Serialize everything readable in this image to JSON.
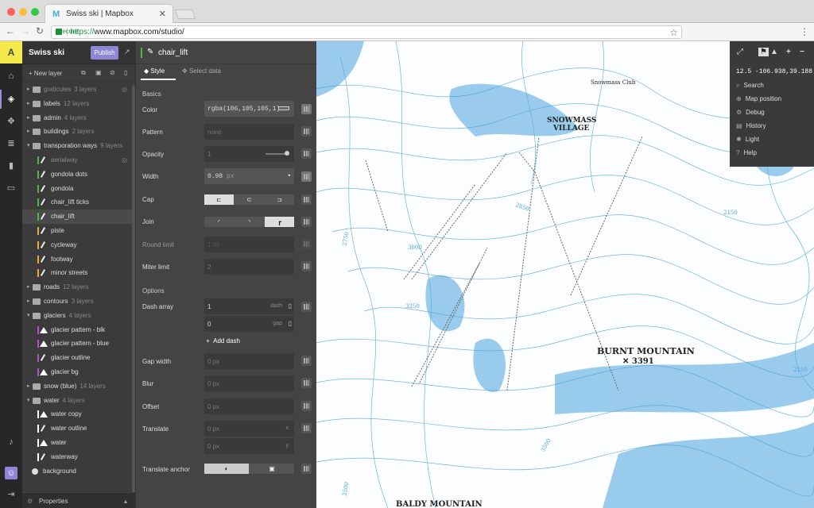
{
  "browser": {
    "tab_title": "Swiss ski | Mapbox",
    "secure_label": "Secure",
    "url_scheme": "https://",
    "url_rest": "www.mapbox.com/studio/"
  },
  "app": {
    "style_name": "Swiss ski",
    "publish_label": "Publish",
    "new_layer_label": "New layer",
    "logo_letter": "A",
    "accent_color": "#8f87d6"
  },
  "layers": [
    {
      "name": "graticules",
      "count": "3 layers",
      "kind": "folder",
      "indent": 0,
      "expanded": false,
      "hidden": true
    },
    {
      "name": "labels",
      "count": "12 layers",
      "kind": "folder",
      "indent": 0,
      "expanded": false
    },
    {
      "name": "admin",
      "count": "4 layers",
      "kind": "folder",
      "indent": 0,
      "expanded": false
    },
    {
      "name": "buildings",
      "count": "2 layers",
      "kind": "folder",
      "indent": 0,
      "expanded": false
    },
    {
      "name": "transporation ways",
      "count": "9 layers",
      "kind": "folder",
      "indent": 0,
      "expanded": true
    },
    {
      "name": "aerialway",
      "count": "",
      "kind": "line",
      "color": "#4db847",
      "indent": 1,
      "hidden": true
    },
    {
      "name": "gondola dots",
      "count": "",
      "kind": "line",
      "color": "#4db847",
      "indent": 1
    },
    {
      "name": "gondola",
      "count": "",
      "kind": "line",
      "color": "#4db847",
      "indent": 1
    },
    {
      "name": "chair_lift ticks",
      "count": "",
      "kind": "line",
      "color": "#4db847",
      "indent": 1
    },
    {
      "name": "chair_lift",
      "count": "",
      "kind": "line",
      "color": "#4db847",
      "indent": 1,
      "selected": true
    },
    {
      "name": "piste",
      "count": "",
      "kind": "line",
      "color": "#f0a830",
      "indent": 1
    },
    {
      "name": "cycleway",
      "count": "",
      "kind": "line",
      "color": "#f0a830",
      "indent": 1
    },
    {
      "name": "footway",
      "count": "",
      "kind": "line",
      "color": "#f0a830",
      "indent": 1
    },
    {
      "name": "minor streets",
      "count": "",
      "kind": "line",
      "color": "#f0a830",
      "indent": 1
    },
    {
      "name": "roads",
      "count": "12 layers",
      "kind": "folder",
      "indent": 0,
      "expanded": false
    },
    {
      "name": "contours",
      "count": "3 layers",
      "kind": "folder",
      "indent": 0,
      "expanded": false
    },
    {
      "name": "glaciers",
      "count": "4 layers",
      "kind": "folder",
      "indent": 0,
      "expanded": true
    },
    {
      "name": "glacier pattern - blk",
      "count": "",
      "kind": "fill",
      "color": "#b44fd0",
      "indent": 1
    },
    {
      "name": "glacier pattern - blue",
      "count": "",
      "kind": "fill",
      "color": "#b44fd0",
      "indent": 1
    },
    {
      "name": "glacier outline",
      "count": "",
      "kind": "line",
      "color": "#b44fd0",
      "indent": 1
    },
    {
      "name": "glacier bg",
      "count": "",
      "kind": "fill",
      "color": "#b44fd0",
      "indent": 1
    },
    {
      "name": "snow (blue)",
      "count": "14 layers",
      "kind": "folder",
      "indent": 0,
      "expanded": false
    },
    {
      "name": "water",
      "count": "4 layers",
      "kind": "folder",
      "indent": 0,
      "expanded": true
    },
    {
      "name": "water copy",
      "count": "",
      "kind": "fill",
      "color": "#ffffff",
      "indent": 1
    },
    {
      "name": "water outline",
      "count": "",
      "kind": "line",
      "color": "#ffffff",
      "indent": 1
    },
    {
      "name": "water",
      "count": "",
      "kind": "fill",
      "color": "#ffffff",
      "indent": 1
    },
    {
      "name": "waterway",
      "count": "",
      "kind": "line",
      "color": "#ffffff",
      "indent": 1
    },
    {
      "name": "background",
      "count": "",
      "kind": "background",
      "indent": 0
    }
  ],
  "properties_label": "Properties",
  "editor": {
    "layer_name": "chair_lift",
    "tab_style": "Style",
    "tab_select": "Select data",
    "section_basics": "Basics",
    "section_options": "Options",
    "color_label": "Color",
    "color_value": "rgba(106,105,105,1)",
    "pattern_label": "Pattern",
    "pattern_value": "none",
    "opacity_label": "Opacity",
    "opacity_value": "1",
    "width_label": "Width",
    "width_value": "0.98",
    "width_unit": "px",
    "cap_label": "Cap",
    "join_label": "Join",
    "round_limit_label": "Round limit",
    "round_limit_value": "1.05",
    "miter_limit_label": "Miter limit",
    "miter_limit_value": "2",
    "dash_array_label": "Dash array",
    "dash_value": "1",
    "dash_suffix": "dash",
    "gap_value": "0",
    "gap_suffix": "gap",
    "add_dash_label": "Add dash",
    "gap_width_label": "Gap width",
    "gap_width_value": "0 px",
    "blur_label": "Blur",
    "blur_value": "0 px",
    "offset_label": "Offset",
    "offset_value": "0 px",
    "translate_label": "Translate",
    "translate_x_value": "0 px",
    "translate_x_suffix": "x",
    "translate_y_value": "0 px",
    "translate_y_suffix": "y",
    "translate_anchor_label": "Translate anchor"
  },
  "map": {
    "labels": {
      "snowmass_club": "Snowmass Club",
      "snowmass": "SNOWMASS",
      "village": "VILLAGE",
      "burnt_mountain": "BURNT MOUNTAIN",
      "burnt_elev": "3391",
      "baldy_mountain": "BALDY MOUNTAIN",
      "c2750": "2750",
      "c2850": "2850",
      "c3000": "3000",
      "c3250": "3250",
      "c3500": "3500",
      "c2150a": "2150",
      "c2150b": "2150",
      "c2500": "2500"
    },
    "tools": {
      "coords": "12.5 -106.938,39.188",
      "search": "Search",
      "map_position": "Map position",
      "debug": "Debug",
      "history": "History",
      "light": "Light",
      "help": "Help"
    },
    "contour_color": "#4aa3df",
    "water_color": "#4aa3df"
  }
}
